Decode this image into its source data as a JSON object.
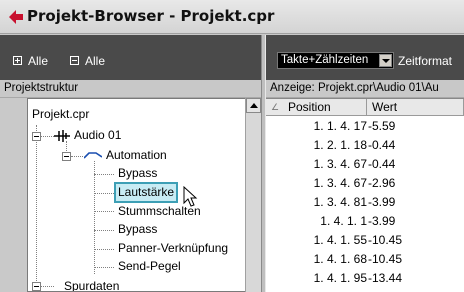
{
  "window": {
    "title": "Projekt-Browser - Projekt.cpr",
    "accent": "#c8102e"
  },
  "toolbar": {
    "expand_all_label": "Alle",
    "collapse_all_label": "Alle",
    "format_select_value": "Takte+Zählzeiten",
    "format_label": "Zeitformat"
  },
  "left_panel": {
    "header": "Projektstruktur",
    "tree": {
      "root": "Projekt.cpr",
      "track": "Audio 01",
      "automation": "Automation",
      "items": [
        "Bypass",
        "Lautstärke",
        "Stummschalten",
        "Bypass",
        "Panner-Verknüpfung",
        "Send-Pegel"
      ],
      "selected": "Lautstärke",
      "trackdata": "Spurdaten"
    }
  },
  "right_panel": {
    "header": "Anzeige: Projekt.cpr\\Audio 01\\Au",
    "columns": [
      "Position",
      "Wert"
    ],
    "rows": [
      {
        "position": "1. 1. 4. 17",
        "value": "-5.59"
      },
      {
        "position": "1. 2. 1. 18",
        "value": "-0.44"
      },
      {
        "position": "1. 3. 4. 67",
        "value": "-0.44"
      },
      {
        "position": "1. 3. 4. 67",
        "value": "-2.96"
      },
      {
        "position": "1. 3. 4. 81",
        "value": "-3.99"
      },
      {
        "position": "1. 4. 1.   1",
        "value": "-3.99"
      },
      {
        "position": "1. 4. 1. 55",
        "value": "-10.45"
      },
      {
        "position": "1. 4. 1. 68",
        "value": "-10.45"
      },
      {
        "position": "1. 4. 1. 95",
        "value": "-13.44"
      }
    ]
  }
}
